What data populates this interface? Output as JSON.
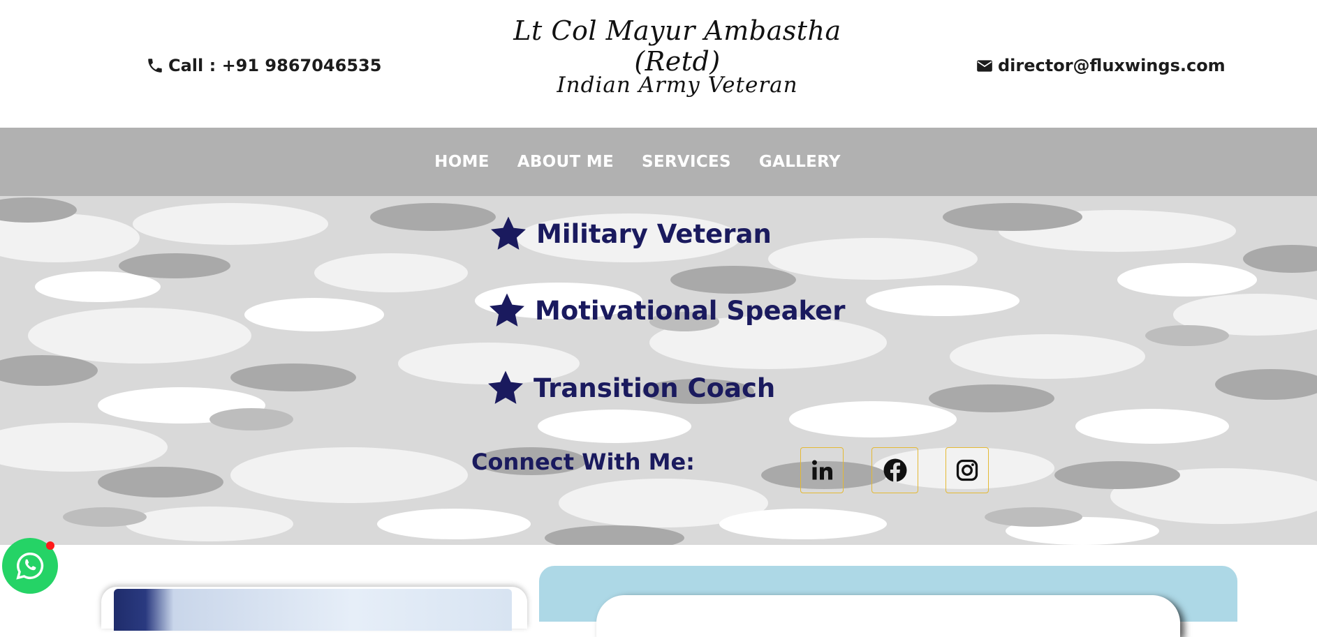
{
  "header": {
    "phone_text": "Call : +91 9867046535",
    "email_text": "director@fluxwings.com",
    "title": "Lt Col Mayur Ambastha (Retd)",
    "subtitle": "Indian Army Veteran",
    "phone_icon": "phone-icon",
    "email_icon": "envelope-icon"
  },
  "nav": {
    "items": [
      {
        "label": "HOME"
      },
      {
        "label": "ABOUT ME"
      },
      {
        "label": "SERVICES"
      },
      {
        "label": "GALLERY"
      }
    ]
  },
  "hero": {
    "taglines": [
      {
        "label": "Military Veteran",
        "icon": "star-icon"
      },
      {
        "label": "Motivational Speaker",
        "icon": "star-icon"
      },
      {
        "label": "Transition Coach",
        "icon": "star-icon"
      }
    ],
    "connect_label": "Connect With Me:",
    "socials": [
      {
        "name": "linkedin-icon"
      },
      {
        "name": "facebook-icon"
      },
      {
        "name": "instagram-icon"
      }
    ]
  },
  "colors": {
    "nav_bg": "#b1b1b1",
    "tagline": "#1a1a5e",
    "social_border": "#e4b934",
    "whatsapp": "#25d366",
    "panel": "#add8e6"
  }
}
